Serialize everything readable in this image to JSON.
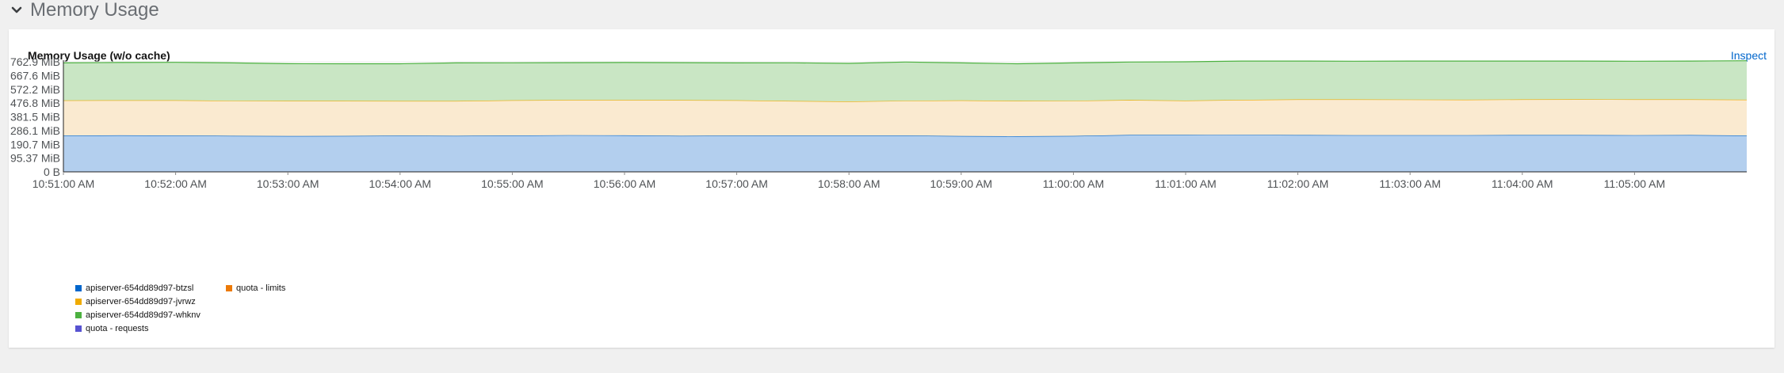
{
  "section": {
    "title": "Memory Usage",
    "chevron_icon": "chevron-down-icon"
  },
  "card": {
    "title": "Memory Usage (w/o cache)",
    "inspect_label": "Inspect"
  },
  "chart_data": {
    "type": "area",
    "stacked": true,
    "title": "Memory Usage (w/o cache)",
    "xlabel": "",
    "ylabel": "",
    "y_unit": "MiB",
    "ylim": [
      0,
      762.9
    ],
    "yticks": [
      "0 B",
      "95.37 MiB",
      "190.7 MiB",
      "286.1 MiB",
      "381.5 MiB",
      "476.8 MiB",
      "572.2 MiB",
      "667.6 MiB",
      "762.9 MiB"
    ],
    "x": [
      "10:51:00 AM",
      "10:51:30 AM",
      "10:52:00 AM",
      "10:52:30 AM",
      "10:53:00 AM",
      "10:53:30 AM",
      "10:54:00 AM",
      "10:54:30 AM",
      "10:55:00 AM",
      "10:55:30 AM",
      "10:56:00 AM",
      "10:56:30 AM",
      "10:57:00 AM",
      "10:57:30 AM",
      "10:58:00 AM",
      "10:58:30 AM",
      "10:59:00 AM",
      "10:59:30 AM",
      "11:00:00 AM",
      "11:00:30 AM",
      "11:01:00 AM",
      "11:01:30 AM",
      "11:02:00 AM",
      "11:02:30 AM",
      "11:03:00 AM",
      "11:03:30 AM",
      "11:04:00 AM",
      "11:04:30 AM",
      "11:05:00 AM",
      "11:05:30 AM",
      "11:05:45 AM"
    ],
    "xticks": [
      "10:51:00 AM",
      "10:52:00 AM",
      "10:53:00 AM",
      "10:54:00 AM",
      "10:55:00 AM",
      "10:56:00 AM",
      "10:57:00 AM",
      "10:58:00 AM",
      "10:59:00 AM",
      "11:00:00 AM",
      "11:01:00 AM",
      "11:02:00 AM",
      "11:03:00 AM",
      "11:04:00 AM",
      "11:05:00 AM"
    ],
    "grid": true,
    "legend_position": "bottom-left",
    "series": [
      {
        "name": "apiserver-654dd89d97-btzsl",
        "color": "#06c",
        "fill": "#b3cfee",
        "values": [
          252,
          253,
          252,
          250,
          248,
          249,
          251,
          250,
          252,
          254,
          253,
          250,
          251,
          252,
          252,
          252,
          248,
          247,
          249,
          256,
          256,
          257,
          255,
          254,
          254,
          254,
          255,
          255,
          254,
          255,
          252
        ]
      },
      {
        "name": "apiserver-654dd89d97-jvrwz",
        "color": "#f0ab00",
        "fill": "#faead0",
        "values": [
          243,
          243,
          244,
          243,
          244,
          243,
          240,
          241,
          244,
          244,
          245,
          247,
          245,
          239,
          236,
          241,
          247,
          245,
          244,
          242,
          238,
          242,
          247,
          248,
          247,
          246,
          247,
          248,
          248,
          247,
          248
        ]
      },
      {
        "name": "apiserver-654dd89d97-whknv",
        "color": "#4cb140",
        "fill": "#c9e6c4",
        "values": [
          260,
          262,
          263,
          262,
          258,
          257,
          258,
          264,
          260,
          259,
          260,
          260,
          259,
          265,
          264,
          268,
          260,
          257,
          262,
          263,
          269,
          269,
          266,
          265,
          267,
          268,
          266,
          265,
          265,
          266,
          270
        ]
      },
      {
        "name": "quota - limits",
        "color": "#ec7a08",
        "fill": "none",
        "values": []
      },
      {
        "name": "quota - requests",
        "color": "#5752d1",
        "fill": "none",
        "values": []
      }
    ]
  }
}
